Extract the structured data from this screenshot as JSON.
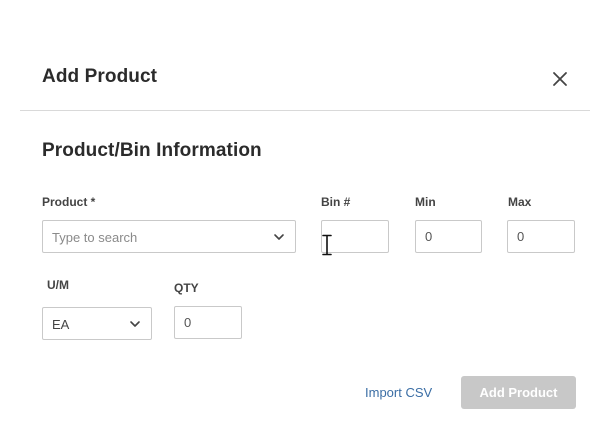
{
  "modal": {
    "title": "Add Product",
    "close_icon": "close-icon"
  },
  "section": {
    "title": "Product/Bin Information"
  },
  "fields": {
    "product": {
      "label": "Product *",
      "placeholder": "Type to search",
      "icon": "chevron-down-icon"
    },
    "bin": {
      "label": "Bin #",
      "value": ""
    },
    "min": {
      "label": "Min",
      "value": "0"
    },
    "max": {
      "label": "Max",
      "value": "0"
    },
    "um": {
      "label": "U/M",
      "value": "EA",
      "icon": "chevron-down-icon"
    },
    "qty": {
      "label": "QTY",
      "value": "0"
    }
  },
  "actions": {
    "import_label": "Import CSV",
    "add_label": "Add Product"
  },
  "colors": {
    "link": "#3b6ea5",
    "disabled_button": "#c8c8c8",
    "border": "#c9c9c9"
  }
}
